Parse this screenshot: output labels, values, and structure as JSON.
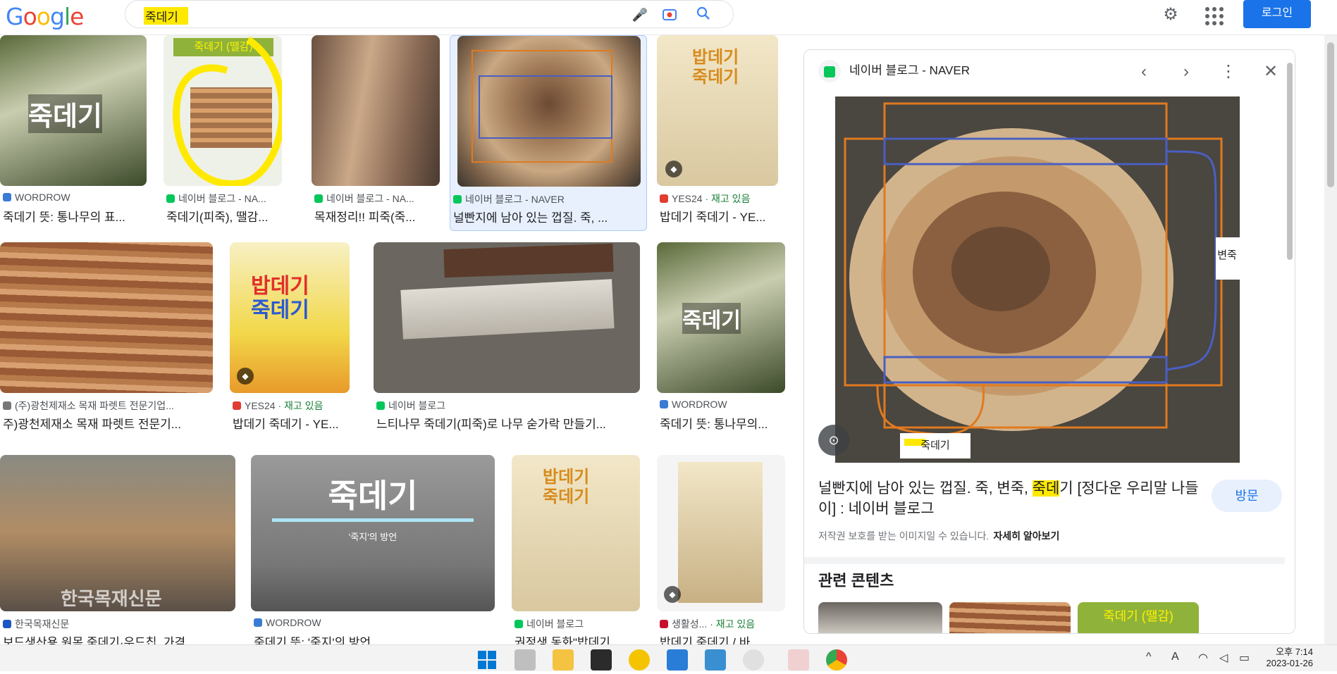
{
  "search": {
    "query": "죽데기"
  },
  "header": {
    "login": "로그인"
  },
  "results": [
    {
      "src": "WORDROW",
      "title": "죽데기 뜻: 통나무의 표...",
      "fav": "#3a7bd5"
    },
    {
      "src": "네이버 블로그 - NA...",
      "title": "죽데기(피죽), 땔감...",
      "fav": "#03c75a"
    },
    {
      "src": "네이버 블로그 - NA...",
      "title": "목재정리!! 피죽(죽...",
      "fav": "#03c75a"
    },
    {
      "src": "네이버 블로그 - NAVER",
      "title": "널빤지에 남아 있는 껍질. 죽, ...",
      "fav": "#03c75a"
    },
    {
      "src": "YES24",
      "stock": "· 재고 있음",
      "title": "밥데기 죽데기 - YE...",
      "fav": "#e03c31"
    },
    {
      "src": "(주)광천제재소 목재 파렛트 전문기업...",
      "title": "주)광천제재소 목재 파렛트 전문기...",
      "fav": "#777777"
    },
    {
      "src": "YES24",
      "stock": "· 재고 있음",
      "title": "밥데기 죽데기 - YE...",
      "fav": "#e03c31"
    },
    {
      "src": "네이버 블로그",
      "title": "느티나무 죽데기(피죽)로 나무 숟가락 만들기...",
      "fav": "#03c75a"
    },
    {
      "src": "WORDROW",
      "title": "죽데기 뜻: 통나무의...",
      "fav": "#3a7bd5"
    },
    {
      "src": "한국목재신문",
      "title": "보드생산용 원목 죽데기·우드칩, 가격 ...",
      "fav": "#1a56c4"
    },
    {
      "src": "WORDROW",
      "title": "죽데기 뜻: '죽지'의 방언",
      "fav": "#3a7bd5"
    },
    {
      "src": "네이버 블로그",
      "title": "권정생 동화\"밥데기 ...",
      "fav": "#03c75a"
    },
    {
      "src": "생활성...",
      "stock": "· 재고 있음",
      "title": "밥데기 죽데기 / 바...",
      "fav": "#c8102e"
    }
  ],
  "thumbs": {
    "jukdegi": "죽데기",
    "jukdegi_quoted": "'죽지'의 방언",
    "firewood": "죽데기 (땔감)",
    "babdegi_1": "밥데기",
    "babdegi_2": "죽데기",
    "newspaper": "한국목재신문"
  },
  "panel": {
    "source": "네이버 블로그 - NAVER",
    "title_a": "널빤지에 남아 있는 껍질. 죽, 변죽, ",
    "title_hl": "죽데",
    "title_b": "기 [정다운 우리말 나들이] : 네이버 블로그",
    "visit": "방문",
    "copyright": "저작권 보호를 받는 이미지일 수 있습니다.",
    "learn_more": "자세히 알아보기",
    "related": "관련 콘텐츠",
    "label_side": "변죽",
    "label_bottom": "죽데기",
    "related_thumb": "죽데기 (땔감)"
  },
  "taskbar": {
    "time": "오후 7:14",
    "date": "2023-01-26"
  }
}
